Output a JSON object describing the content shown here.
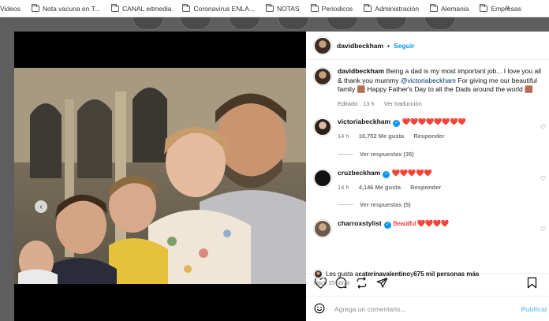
{
  "bookmarks": {
    "items": [
      {
        "label": "Videos",
        "folder": false
      },
      {
        "label": "Nota vacuna en T...",
        "folder": true
      },
      {
        "label": "CANAL eitmedia",
        "folder": true
      },
      {
        "label": "Coronavirus ENLA...",
        "folder": true
      },
      {
        "label": "NOTAS",
        "folder": true
      },
      {
        "label": "Periodicos",
        "folder": true
      },
      {
        "label": "Administración",
        "folder": true
      },
      {
        "label": "Alemania",
        "folder": true
      },
      {
        "label": "Empresas",
        "folder": true
      }
    ],
    "more": "»"
  },
  "post": {
    "username": "davidbeckham",
    "separator": "•",
    "follow_label": "Seguir",
    "caption_user": "davidbeckham",
    "caption_part1": "Being a dad is my most important job... I love you all & thank you mummy ",
    "caption_mention": "@victoriabeckham",
    "caption_part2": " For giving me our beautiful family 🟫 Happy Father's Day to all the Dads around the world 🟫",
    "caption_meta_edited": "Editado · 13 h",
    "caption_meta_translate": "Ver traducción",
    "likes_prefix": "Les gusta a ",
    "likes_user": "caterinavalentino",
    "likes_middle": " y ",
    "likes_count": "675 mil personas más",
    "time_ago": "Hace 15 horas",
    "comment_placeholder": "Agrega un comentario...",
    "publish_label": "Publicar"
  },
  "comments": [
    {
      "user": "victoriabeckham",
      "text": "❤️❤️❤️❤️❤️❤️❤️❤️",
      "time": "14 h",
      "likes": "10,752 Me gusta",
      "reply": "Responder",
      "replies": "Ver respuestas (35)"
    },
    {
      "user": "cruzbeckham",
      "text": "❤️❤️❤️❤️❤️",
      "time": "14 h",
      "likes": "4,146 Me gusta",
      "reply": "Responder",
      "replies": "Ver respuestas (5)"
    },
    {
      "user": "charroxstylist",
      "text": "Beautiful ❤️❤️❤️❤️"
    }
  ],
  "colors": {
    "accent": "#0095f6",
    "heart": "#ed1c24",
    "backdrop": "#5e5e5e"
  }
}
